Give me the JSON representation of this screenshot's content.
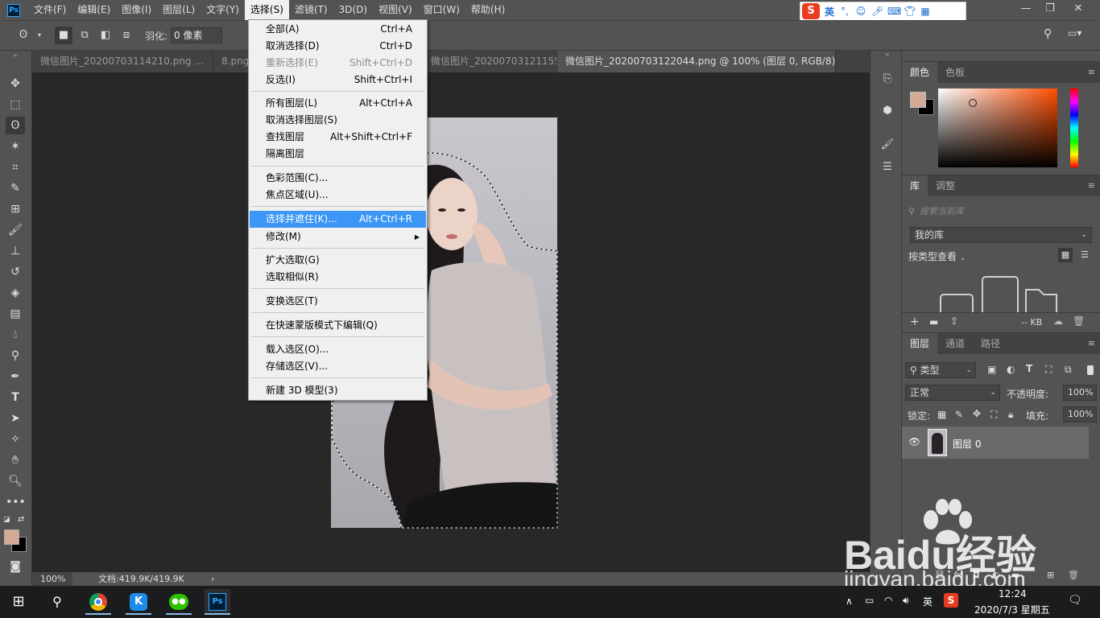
{
  "menubar": {
    "logo": "Ps",
    "items": [
      "文件(F)",
      "编辑(E)",
      "图像(I)",
      "图层(L)",
      "文字(Y)",
      "选择(S)",
      "滤镜(T)",
      "3D(D)",
      "视图(V)",
      "窗口(W)",
      "帮助(H)"
    ],
    "window_controls": [
      "—",
      "❐",
      "✕"
    ]
  },
  "ime": {
    "logo": "S",
    "lang": "英"
  },
  "options": {
    "feather_label": "羽化:",
    "feather_value": "0 像素"
  },
  "tabs": [
    "微信图片_20200703114210.png ...",
    "8.png",
    "微信图片_20200703121155.png ...",
    "微信图片_20200703122044.png @ 100% (图层 0, RGB/8)"
  ],
  "select_menu": {
    "groups": [
      [
        {
          "label": "全部(A)",
          "shortcut": "Ctrl+A"
        },
        {
          "label": "取消选择(D)",
          "shortcut": "Ctrl+D"
        },
        {
          "label": "重新选择(E)",
          "shortcut": "Shift+Ctrl+D",
          "disabled": true
        },
        {
          "label": "反选(I)",
          "shortcut": "Shift+Ctrl+I"
        }
      ],
      [
        {
          "label": "所有图层(L)",
          "shortcut": "Alt+Ctrl+A"
        },
        {
          "label": "取消选择图层(S)",
          "shortcut": ""
        },
        {
          "label": "查找图层",
          "shortcut": "Alt+Shift+Ctrl+F"
        },
        {
          "label": "隔离图层",
          "shortcut": ""
        }
      ],
      [
        {
          "label": "色彩范围(C)...",
          "shortcut": ""
        },
        {
          "label": "焦点区域(U)...",
          "shortcut": ""
        }
      ],
      [
        {
          "label": "选择并遮住(K)...",
          "shortcut": "Alt+Ctrl+R",
          "highlight": true
        },
        {
          "label": "修改(M)",
          "shortcut": "",
          "submenu": true
        }
      ],
      [
        {
          "label": "扩大选取(G)",
          "shortcut": ""
        },
        {
          "label": "选取相似(R)",
          "shortcut": ""
        }
      ],
      [
        {
          "label": "变换选区(T)",
          "shortcut": ""
        }
      ],
      [
        {
          "label": "在快速蒙版模式下编辑(Q)",
          "shortcut": ""
        }
      ],
      [
        {
          "label": "载入选区(O)...",
          "shortcut": ""
        },
        {
          "label": "存储选区(V)...",
          "shortcut": ""
        }
      ],
      [
        {
          "label": "新建 3D 模型(3)",
          "shortcut": ""
        }
      ]
    ]
  },
  "status": {
    "zoom": "100%",
    "doc": "文档:419.9K/419.9K"
  },
  "color_panel": {
    "tabs": [
      "颜色",
      "色板"
    ],
    "fg_color": "#d4aa96",
    "bg_color": "#000000"
  },
  "library_panel": {
    "tabs": [
      "库",
      "调整"
    ],
    "search_placeholder": "搜索当前库",
    "library_name": "我的库",
    "view_by": "按类型查看",
    "size": "-- KB"
  },
  "layers_panel": {
    "tabs": [
      "图层",
      "通道",
      "路径"
    ],
    "filter": "类型",
    "blend_mode": "正常",
    "opacity_label": "不透明度:",
    "opacity": "100%",
    "lock_label": "锁定:",
    "fill_label": "填充:",
    "fill": "100%",
    "layers": [
      {
        "name": "图层 0"
      }
    ]
  },
  "taskbar": {
    "ime": "英",
    "time": "12:24",
    "date": "2020/7/3 星期五"
  },
  "watermark": {
    "brand": "Baidu经验",
    "url": "jingyan.baidu.com"
  }
}
